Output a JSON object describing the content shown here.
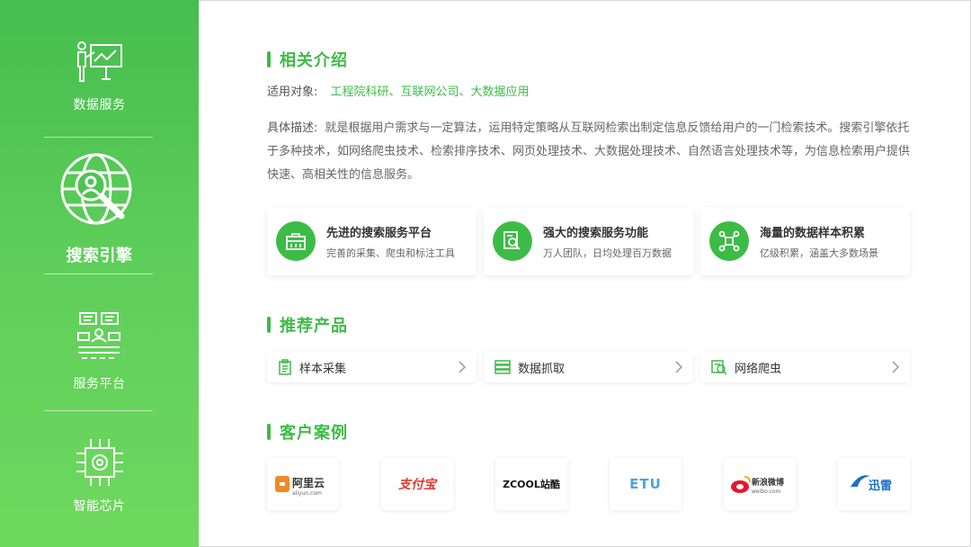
{
  "sidebar": {
    "items": [
      {
        "label": "数据服务",
        "icon": "presentation-board-icon"
      },
      {
        "label": "搜索引擎",
        "icon": "globe-magnifier-icon",
        "active": true
      },
      {
        "label": "服务平台",
        "icon": "chat-people-icon"
      },
      {
        "label": "智能芯片",
        "icon": "chip-icon"
      }
    ]
  },
  "intro": {
    "title": "相关介绍",
    "target_label": "适用对象:",
    "target_value": "工程院科研、互联网公司、大数据应用",
    "desc_label": "具体描述:",
    "desc_text": "就是根据用户需求与一定算法，运用特定策略从互联网检索出制定信息反馈给用户的一门检索技术。搜索引擎依托于多种技术，如网络爬虫技术、检索排序技术、网页处理技术、大数据处理技术、自然语言处理技术等，为信息检索用户提供快速、高相关性的信息服务。"
  },
  "features": [
    {
      "title": "先进的搜索服务平台",
      "sub": "完善的采集、爬虫和标注工具",
      "icon": "toolbox-icon"
    },
    {
      "title": "强大的搜索服务功能",
      "sub": "万人团队，日均处理百万数据",
      "icon": "search-document-icon"
    },
    {
      "title": "海量的数据样本积累",
      "sub": "亿级积累，涵盖大多数场景",
      "icon": "network-nodes-icon"
    }
  ],
  "products": {
    "title": "推荐产品",
    "items": [
      {
        "name": "样本采集",
        "icon": "clipboard-icon"
      },
      {
        "name": "数据抓取",
        "icon": "database-list-icon"
      },
      {
        "name": "网络爬虫",
        "icon": "web-search-icon"
      }
    ]
  },
  "cases": {
    "title": "客户案例",
    "logos": [
      {
        "text": "阿里云",
        "sub": "aliyun.com",
        "color": "#f08a24"
      },
      {
        "text": "支付宝",
        "color": "#e8382f"
      },
      {
        "text": "ZCOOL站酷",
        "color": "#111111"
      },
      {
        "text": "ETU",
        "color": "#4aa3df"
      },
      {
        "text": "新浪微博",
        "sub": "weibo.com",
        "color": "#e6162d"
      },
      {
        "text": "迅雷",
        "color": "#1a6fc8"
      }
    ]
  },
  "colors": {
    "accent": "#3dbb47",
    "sidebar": "#4cc452"
  }
}
